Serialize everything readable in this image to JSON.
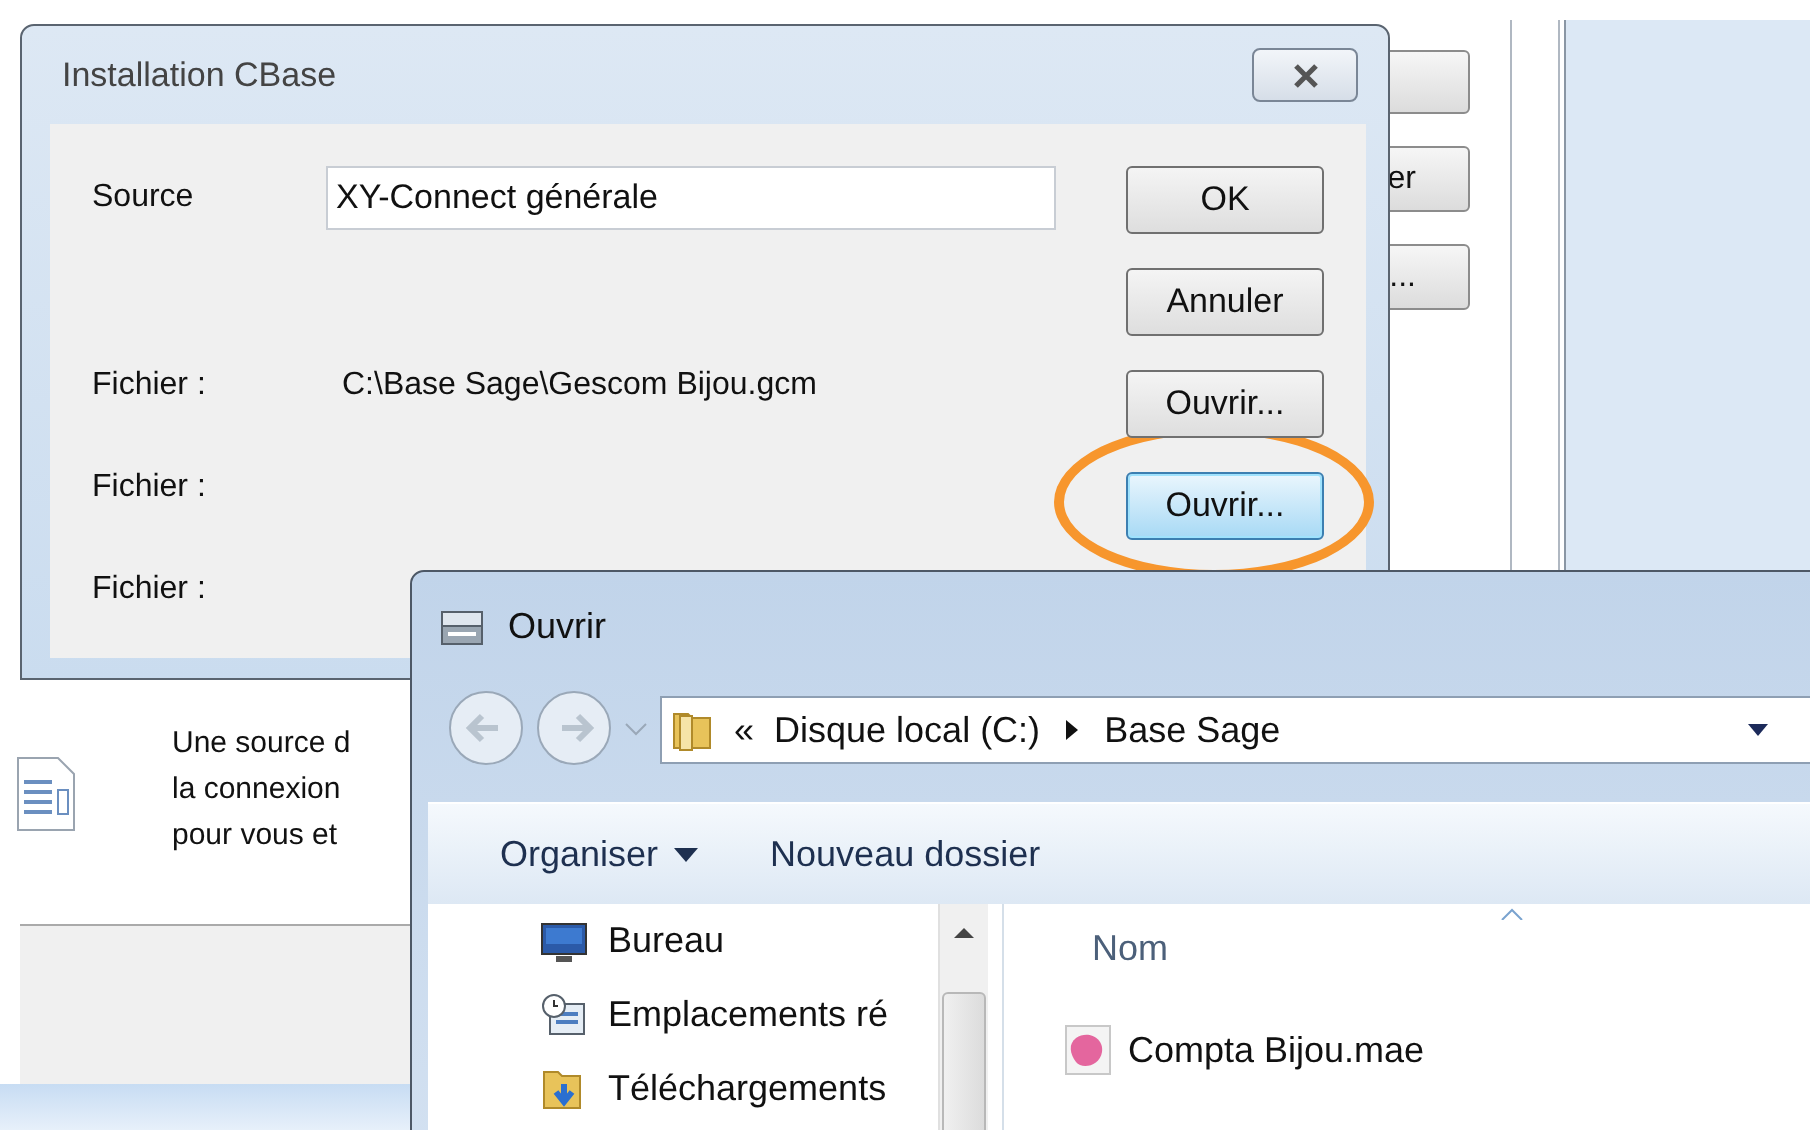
{
  "background_window": {
    "buttons": [
      {
        "label": "er"
      },
      {
        "label": "..."
      }
    ],
    "description_lines": [
      "Une source d",
      "la connexion",
      "pour vous et"
    ]
  },
  "dialog": {
    "title": "Installation CBase",
    "source": {
      "label": "Source",
      "value": "XY-Connect générale"
    },
    "files": [
      {
        "label": "Fichier :",
        "path": "C:\\Base Sage\\Gescom Bijou.gcm"
      },
      {
        "label": "Fichier :"
      },
      {
        "label": "Fichier :"
      }
    ],
    "buttons": [
      {
        "label": "OK",
        "highlighted": false,
        "circled": false
      },
      {
        "label": "Annuler",
        "highlighted": false,
        "circled": false
      },
      {
        "label": "Ouvrir...",
        "highlighted": false,
        "circled": false
      },
      {
        "label": "Ouvrir...",
        "highlighted": true,
        "circled": true
      }
    ]
  },
  "open_dialog": {
    "title": "Ouvrir",
    "address": {
      "overflow": "«",
      "crumbs": [
        "Disque local (C:)",
        "Base Sage"
      ]
    },
    "toolbar": [
      {
        "label": "Organiser",
        "dropdown": true
      },
      {
        "label": "Nouveau dossier",
        "dropdown": false
      }
    ],
    "nav_items": [
      {
        "label": "Bureau",
        "kind": "desktop"
      },
      {
        "label": "Emplacements ré",
        "kind": "recent"
      },
      {
        "label": "Téléchargements",
        "kind": "downloads"
      }
    ],
    "column": "Nom",
    "files": [
      {
        "name": "Compta Bijou.mae"
      }
    ]
  }
}
